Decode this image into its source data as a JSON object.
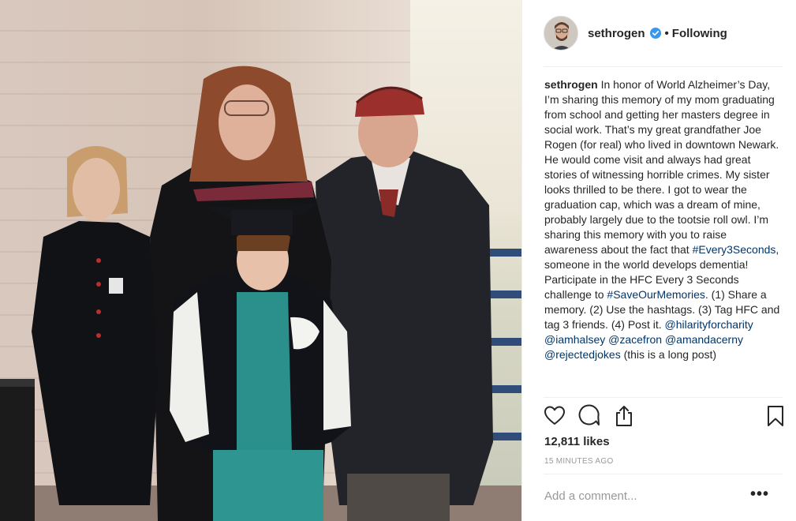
{
  "post": {
    "image_alt": "Family photo at a graduation",
    "username": "sethrogen",
    "separator": "•",
    "follow_status": "Following",
    "caption": {
      "username": "sethrogen",
      "segments": [
        {
          "type": "text",
          "text": " In honor of World Alzheimer’s Day, I’m sharing this memory of my mom graduating from school and getting her masters degree in social work. That’s my great grandfather Joe Rogen (for real) who lived in downtown Newark. He would come visit and always had great stories of witnessing horrible crimes. My sister looks thrilled to be there. I got to wear the graduation cap, which was a dream of mine, probably largely due to the tootsie roll owl. I’m sharing this memory with you to raise awareness about the fact that "
        },
        {
          "type": "tag",
          "text": "#Every3Seconds"
        },
        {
          "type": "text",
          "text": ", someone in the world develops dementia! Participate in the HFC Every 3 Seconds challenge to "
        },
        {
          "type": "tag",
          "text": "#SaveOurMemories"
        },
        {
          "type": "text",
          "text": ". (1) Share a memory. (2) Use the hashtags. (3) Tag HFC and tag 3 friends. (4) Post it. "
        },
        {
          "type": "tag",
          "text": "@hilarityforcharity"
        },
        {
          "type": "text",
          "text": " "
        },
        {
          "type": "tag",
          "text": "@iamhalsey"
        },
        {
          "type": "text",
          "text": " "
        },
        {
          "type": "tag",
          "text": "@zacefron"
        },
        {
          "type": "text",
          "text": " "
        },
        {
          "type": "tag",
          "text": "@amandacerny"
        },
        {
          "type": "text",
          "text": " "
        },
        {
          "type": "tag",
          "text": "@rejectedjokes"
        },
        {
          "type": "text",
          "text": " (this is a long post)"
        }
      ]
    },
    "likes": "12,811 likes",
    "timestamp": "15 MINUTES AGO",
    "comment_placeholder": "Add a comment...",
    "more_label": "•••"
  },
  "icons": {
    "like": "heart-icon",
    "comment": "comment-bubble-icon",
    "share": "share-icon",
    "save": "bookmark-icon",
    "verified": "verified-badge-icon"
  },
  "colors": {
    "link": "#003569",
    "verified": "#3897f0",
    "muted": "#999999",
    "text": "#262626"
  }
}
